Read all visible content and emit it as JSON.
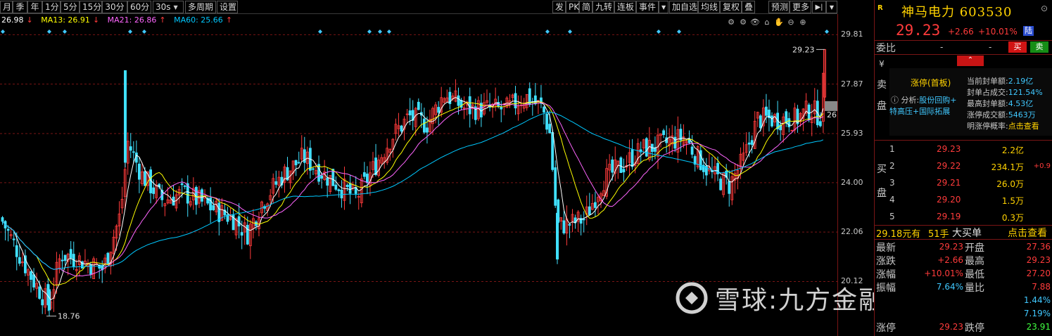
{
  "toolbar": {
    "left_items": [
      "月",
      "季",
      "年",
      "1分",
      "5分",
      "15分",
      "30分",
      "60分"
    ],
    "interval_select": "30s",
    "multi_period": "多周期",
    "settings": "设置",
    "right_items": [
      "发",
      "PK",
      "简",
      "九转",
      "连板",
      "事件"
    ],
    "right_items2": [
      "加自选",
      "均线",
      "复权",
      "叠",
      "预测",
      "更多"
    ],
    "arrow_right": "▶|",
    "arrow_down": "▼"
  },
  "ma_legend": {
    "close": "26.98",
    "close_arrow": "↓",
    "ma13": "MA13: 26.91",
    "ma13_arrow": "↓",
    "ma21": "MA21: 26.86",
    "ma21_arrow": "↑",
    "ma60": "MA60: 25.66",
    "ma60_arrow": "↑"
  },
  "chart_icons": [
    "gear-icon",
    "settings-icon",
    "eye-icon",
    "store-icon",
    "hand-icon",
    "minus-icon",
    "plus-icon"
  ],
  "chart_icon_glyphs": [
    "⚙",
    "⚙",
    "👁",
    "⌂",
    "✋",
    "⊖",
    "⊕"
  ],
  "price_axis": [
    "29.81",
    "27.87",
    "25.93",
    "24.00",
    "22.06",
    "20.12"
  ],
  "chart_labels": {
    "high": "29.23",
    "low": "18.76",
    "cursor": "26"
  },
  "chart_data": {
    "type": "candlestick",
    "ylim": [
      18.2,
      30.4
    ],
    "y_ticks": [
      29.81,
      27.87,
      25.93,
      24.0,
      22.06,
      20.12
    ],
    "series": [
      {
        "name": "MA13",
        "value": 26.91
      },
      {
        "name": "MA21",
        "value": 26.86
      },
      {
        "name": "MA60",
        "value": 25.66
      }
    ],
    "highest": 29.23,
    "lowest": 18.76,
    "last_close": 26.98
  },
  "colors": {
    "up": "#ff3b3b",
    "down": "#40e0ff",
    "ma5": "#ffffff",
    "ma13": "#ffff00",
    "ma21": "#ff66ff",
    "ma60": "#00c8ff",
    "grid": "#7a1515",
    "accent": "#ffd200"
  },
  "panel": {
    "badge": "R",
    "name": "神马电力",
    "code": "603530",
    "last": "29.23",
    "change": "+2.66",
    "pct": "+10.01%",
    "market_tag": "陆",
    "weibi_label": "委比",
    "weibi_dash1": "-",
    "weibi_dash2": "-",
    "buy_btn": "买",
    "sell_btn": "卖",
    "arrow": "⌃",
    "sell_side_label": [
      "¥",
      "卖",
      "盘"
    ],
    "limit": {
      "title": "涨停(首板)",
      "analysis_label": "ⓘ 分析:",
      "analysis_val": "股份回购+",
      "analysis_val2": "特高压+国际拓展",
      "k1": "当前封单额:",
      "v1": "2.19亿",
      "k2": "封单占成交:",
      "v2": "121.54%",
      "k3": "最高封单额:",
      "v3": "4.53亿",
      "k4": "涨停成交额:",
      "v4": "5463万",
      "k5": "明涨停概率:",
      "v5": "点击查看"
    },
    "buy_side_label": [
      "买",
      "盘"
    ],
    "bids": [
      {
        "n": "1",
        "price": "29.23",
        "vol": "2.2亿",
        "extra": ""
      },
      {
        "n": "2",
        "price": "29.22",
        "vol": "234.1万",
        "extra": "+0.9"
      },
      {
        "n": "3",
        "price": "29.21",
        "vol": "26.0万",
        "extra": ""
      },
      {
        "n": "4",
        "price": "29.20",
        "vol": "1.5万",
        "extra": ""
      },
      {
        "n": "5",
        "price": "29.19",
        "vol": "0.3万",
        "extra": ""
      }
    ],
    "big_order": {
      "price": "29.18元有",
      "hands": "51手",
      "label": "大买单",
      "link": "点击查看"
    },
    "quotes": [
      {
        "l": "最新",
        "v": "29.23",
        "l2": "开盘",
        "v2": "27.36",
        "c1": "#ff3b3b",
        "c2": "#ff3b3b"
      },
      {
        "l": "涨跌",
        "v": "+2.66",
        "l2": "最高",
        "v2": "29.23",
        "c1": "#ff3b3b",
        "c2": "#ff3b3b"
      },
      {
        "l": "涨幅",
        "v": "+10.01%",
        "l2": "最低",
        "v2": "27.20",
        "c1": "#ff3b3b",
        "c2": "#ff3b3b"
      },
      {
        "l": "振幅",
        "v": "7.64%",
        "l2": "量比",
        "v2": "7.88",
        "c1": "#40c8ff",
        "c2": "#ff3b3b"
      },
      {
        "l": "",
        "v": "",
        "l2": "",
        "v2": "1.44%",
        "c1": "#40c8ff",
        "c2": "#40c8ff"
      },
      {
        "l": "",
        "v": "",
        "l2": "",
        "v2": "7.19%",
        "c1": "#40c8ff",
        "c2": "#40c8ff"
      },
      {
        "l": "涨停",
        "v": "29.23",
        "l2": "跌停",
        "v2": "23.91",
        "c1": "#ff3b3b",
        "c2": "#40ff40"
      }
    ]
  },
  "watermark": "雪球:九方金融研究所"
}
